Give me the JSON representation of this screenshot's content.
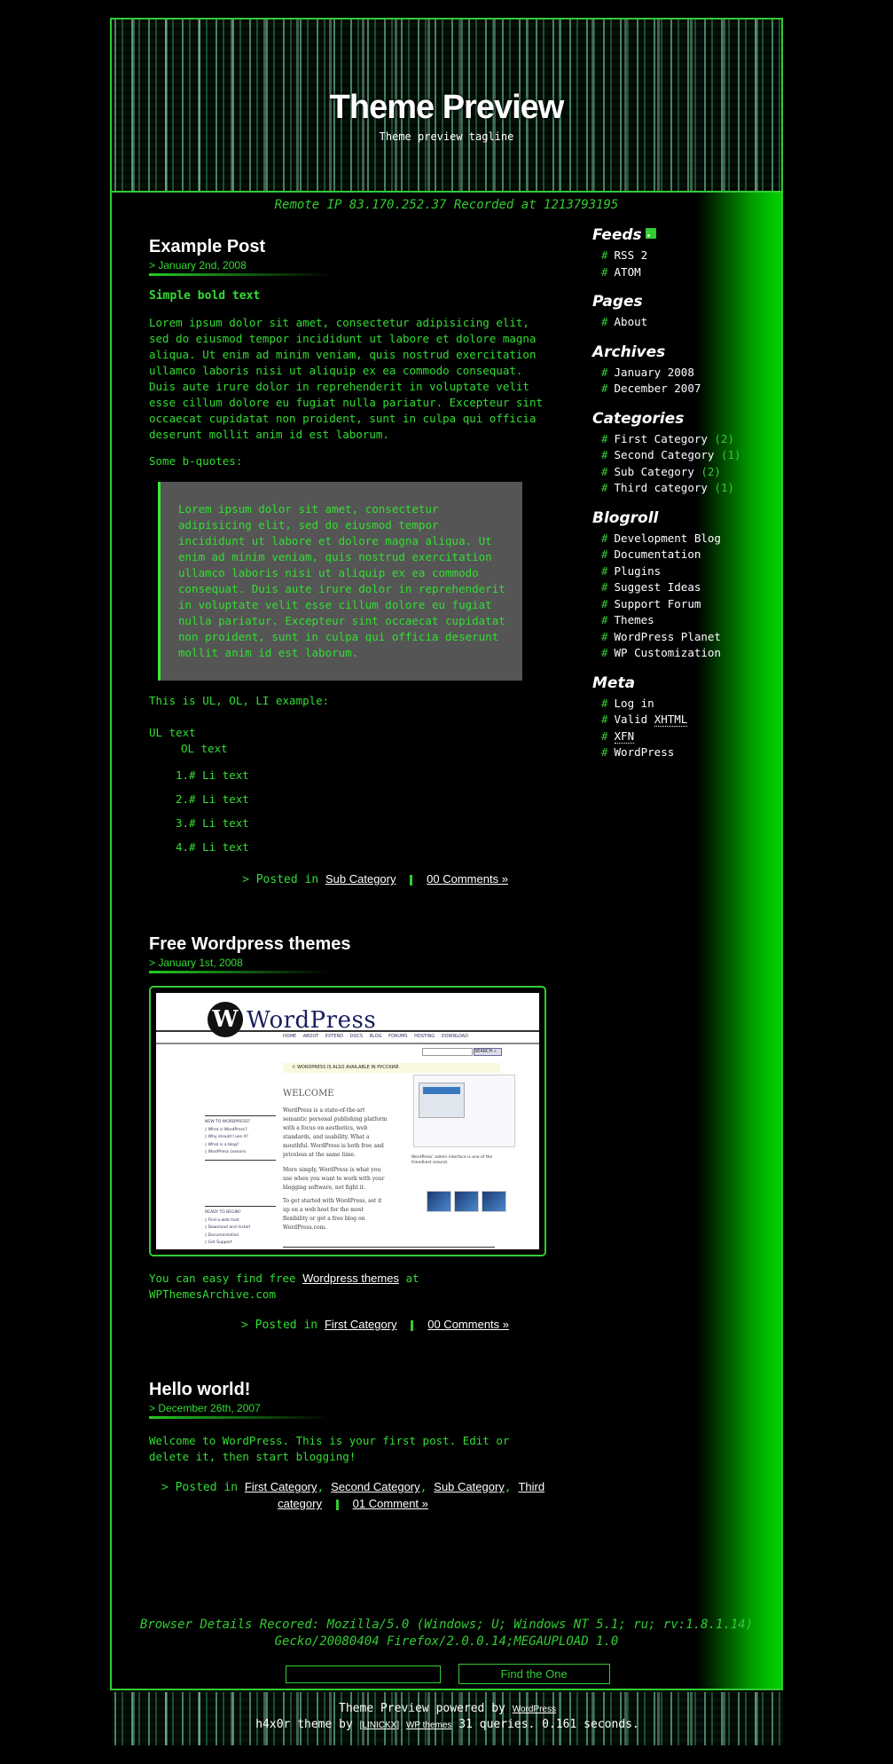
{
  "header": {
    "title": "Theme Preview",
    "tagline": "Theme preview tagline"
  },
  "remote_ip_line": "Remote IP 83.170.252.37 Recorded at 1213793195",
  "colors": {
    "accent_green": "#33cc33",
    "background": "#000000",
    "blockquote_bg": "#555555",
    "heading_white": "#ffffff"
  },
  "posts": [
    {
      "title": "Example Post",
      "date": "January 2nd, 2008",
      "bold_text": "Simple bold text",
      "paragraph": "Lorem ipsum dolor sit amet, consectetur adipisicing elit, sed do eiusmod tempor incididunt ut labore et dolore magna aliqua. Ut enim ad minim veniam, quis nostrud exercitation ullamco laboris nisi ut aliquip ex ea commodo consequat. Duis aute irure dolor in reprehenderit in voluptate velit esse cillum dolore eu fugiat nulla pariatur. Excepteur sint occaecat cupidatat non proident, sunt in culpa qui officia deserunt mollit anim id est laborum.",
      "bquote_intro": "Some b-quotes:",
      "blockquote": "Lorem ipsum dolor sit amet, consectetur adipisicing elit, sed do eiusmod tempor incididunt ut labore et dolore magna aliqua. Ut enim ad minim veniam, quis nostrud exercitation ullamco laboris nisi ut aliquip ex ea commodo consequat. Duis aute irure dolor in reprehenderit in voluptate velit esse cillum dolore eu fugiat nulla pariatur. Excepteur sint occaecat cupidatat non proident, sunt in culpa qui officia deserunt mollit anim id est laborum.",
      "list_intro": "This is UL, OL, LI example:",
      "ul_text": "UL text",
      "ol_text": "OL text",
      "li_items": [
        "1.# Li text",
        "2.# Li text",
        "3.# Li text",
        "4.# Li text"
      ],
      "meta": {
        "arrow": ">",
        "posted_in": "Posted in",
        "categories": [
          "Sub Category"
        ],
        "comments": "00 Comments »"
      }
    },
    {
      "title": "Free Wordpress themes",
      "date": "January 1st, 2008",
      "image": {
        "logo_glyph": "W",
        "logo_text": "WordPress",
        "nav": "HOME ABOUT EXTEND DOCS BLOG FORUMS HOSTING DOWNLOAD",
        "search_btn": "SEARCH »",
        "available": "☼ WORDPRESS IS ALSO AVAILABLE IN РУССКИЙ.",
        "welcome": "WELCOME",
        "para1": "WordPress is a state-of-the-art semantic personal publishing platform with a focus on aesthetics, web standards, and usability. What a mouthful. WordPress is both free and priceless at the same time.",
        "para2": "More simply, WordPress is what you use when you want to work with your blogging software, not fight it.",
        "para3": "To get started with WordPress, set it up on a web host for the most flexibility or get a free blog on WordPress.com.",
        "side1_title": "NEW TO WORDPRESS?",
        "side1_items": [
          "◊ What is WordPress?",
          "◊ Why should I use it?",
          "◊ What is a blog?",
          "◊ WordPress Lessons"
        ],
        "side2_title": "READY TO BEGIN?",
        "side2_items": [
          "◊ Find a web host",
          "◊ Download and Install",
          "◊ Documentation",
          "◊ Get Support"
        ],
        "caption": "WordPress' admin interface is one of the friendliest around."
      },
      "text_before": "You can easy find free ",
      "text_link": "Wordpress themes",
      "text_after": " at WPThemesArchive.com",
      "meta": {
        "arrow": ">",
        "posted_in": "Posted in",
        "categories": [
          "First Category"
        ],
        "comments": "00 Comments »"
      }
    },
    {
      "title": "Hello world!",
      "date": "December 26th, 2007",
      "paragraph": "Welcome to WordPress. This is your first post. Edit or delete it, then start blogging!",
      "meta": {
        "arrow": ">",
        "posted_in": "Posted in",
        "categories": [
          "First Category",
          "Second Category",
          "Sub Category",
          "Third category"
        ],
        "comments": "01 Comment »"
      }
    }
  ],
  "sidebar": {
    "feeds": {
      "title": "Feeds",
      "icon": "rss-icon",
      "items": [
        "RSS 2",
        "ATOM"
      ]
    },
    "pages": {
      "title": "Pages",
      "items": [
        "About"
      ]
    },
    "archives": {
      "title": "Archives",
      "items": [
        "January 2008",
        "December 2007"
      ]
    },
    "categories": {
      "title": "Categories",
      "items": [
        {
          "label": "First Category",
          "count": "(2)"
        },
        {
          "label": "Second Category",
          "count": "(1)"
        },
        {
          "label": "Sub Category",
          "count": "(2)"
        },
        {
          "label": "Third category",
          "count": "(1)"
        }
      ]
    },
    "blogroll": {
      "title": "Blogroll",
      "items": [
        "Development Blog",
        "Documentation",
        "Plugins",
        "Suggest Ideas",
        "Support Forum",
        "Themes",
        "WordPress Planet",
        "WP Customization"
      ]
    },
    "meta": {
      "title": "Meta",
      "items": [
        {
          "pre": "Log in",
          "abbr": ""
        },
        {
          "pre": "Valid ",
          "abbr": "XHTML"
        },
        {
          "pre": "",
          "abbr": "XFN"
        },
        {
          "pre": "WordPress",
          "abbr": ""
        }
      ]
    },
    "bullet": "#"
  },
  "browser_details": "Browser Details Recored: Mozilla/5.0 (Windows; U; Windows NT 5.1; ru; rv:1.8.1.14) Gecko/20080404 Firefox/2.0.0.14;MEGAUPLOAD 1.0",
  "search": {
    "input_value": "",
    "button_label": "Find the One"
  },
  "footer": {
    "line1_text": "Theme Preview powered by ",
    "line1_link": "WordPress",
    "line2_text1": "h4x0r theme by ",
    "line2_link1": "[LINICKX]",
    "line2_link2": "WP themes",
    "line2_text2": " 31 queries. 0.161 seconds."
  }
}
